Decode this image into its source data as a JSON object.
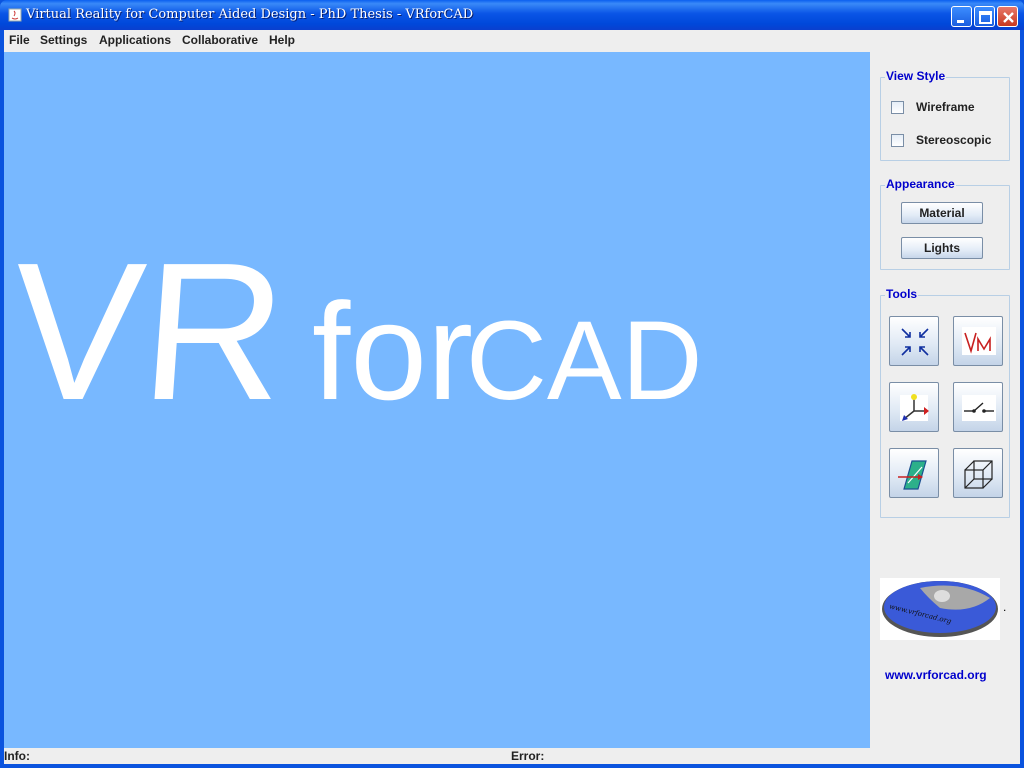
{
  "window": {
    "title": "Virtual Reality for Computer Aided Design - PhD Thesis  - VRforCAD"
  },
  "menu": {
    "items": [
      "File",
      "Settings",
      "Applications",
      "Collaborative",
      "Help"
    ]
  },
  "canvas": {
    "background_color": "#78B8FF",
    "big_text": {
      "part1": "VR",
      "part2": "for",
      "part3": "CAD"
    }
  },
  "sidepanel": {
    "view_style": {
      "title": "View Style",
      "options": [
        {
          "label": "Wireframe",
          "checked": false
        },
        {
          "label": "Stereoscopic",
          "checked": false
        }
      ]
    },
    "appearance": {
      "title": "Appearance",
      "buttons": [
        "Material",
        "Lights"
      ]
    },
    "tools": {
      "title": "Tools",
      "icons": [
        "zoom-fit-icon",
        "vm-icon",
        "axes-icon",
        "switch-icon",
        "section-plane-icon",
        "bounding-box-icon"
      ]
    },
    "logo": {
      "text": "www.vrforcad.org"
    },
    "link": "www.vrforcad.org"
  },
  "statusbar": {
    "info_label": "Info:",
    "info_value": "",
    "error_label": "Error:",
    "error_value": ""
  },
  "colors": {
    "accent": "#0000CC",
    "titlebar": "#0A55E6",
    "canvas": "#78B8FF"
  }
}
